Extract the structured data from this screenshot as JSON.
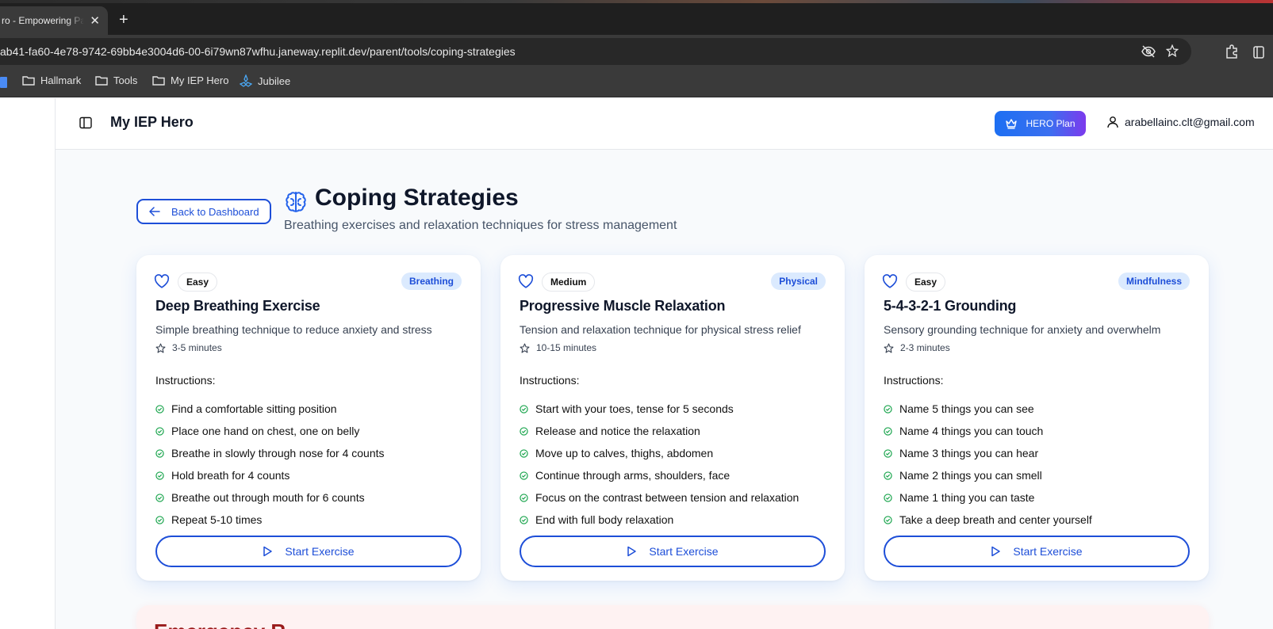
{
  "browser": {
    "tab_title": "ro - Empowering Pa",
    "tab_close": "✕",
    "new_tab": "+",
    "url": "ab41-fa60-4e78-9742-69bb4e3004d6-00-6i79wn87wfhu.janeway.replit.dev/parent/tools/coping-strategies",
    "bookmarks": [
      "Hallmark",
      "Tools",
      "My IEP Hero",
      "Jubilee"
    ]
  },
  "header": {
    "app_title": "My IEP Hero",
    "plan_label": "HERO Plan",
    "user_email": "arabellainc.clt@gmail.com"
  },
  "page": {
    "back_label": "Back to Dashboard",
    "title": "Coping Strategies",
    "subtitle": "Breathing exercises and relaxation techniques for stress management"
  },
  "cards": [
    {
      "difficulty": "Easy",
      "category": "Breathing",
      "title": "Deep Breathing Exercise",
      "description": "Simple breathing technique to reduce anxiety and stress",
      "duration": "3-5 minutes",
      "instructions_label": "Instructions:",
      "steps": [
        "Find a comfortable sitting position",
        "Place one hand on chest, one on belly",
        "Breathe in slowly through nose for 4 counts",
        "Hold breath for 4 counts",
        "Breathe out through mouth for 6 counts",
        "Repeat 5-10 times"
      ],
      "button_label": "Start Exercise"
    },
    {
      "difficulty": "Medium",
      "category": "Physical",
      "title": "Progressive Muscle Relaxation",
      "description": "Tension and relaxation technique for physical stress relief",
      "duration": "10-15 minutes",
      "instructions_label": "Instructions:",
      "steps": [
        "Start with your toes, tense for 5 seconds",
        "Release and notice the relaxation",
        "Move up to calves, thighs, abdomen",
        "Continue through arms, shoulders, face",
        "Focus on the contrast between tension and relaxation",
        "End with full body relaxation"
      ],
      "button_label": "Start Exercise"
    },
    {
      "difficulty": "Easy",
      "category": "Mindfulness",
      "title": "5-4-3-2-1 Grounding",
      "description": "Sensory grounding technique for anxiety and overwhelm",
      "duration": "2-3 minutes",
      "instructions_label": "Instructions:",
      "steps": [
        "Name 5 things you can see",
        "Name 4 things you can touch",
        "Name 3 things you can hear",
        "Name 2 things you can smell",
        "Name 1 thing you can taste",
        "Take a deep breath and center yourself"
      ],
      "button_label": "Start Exercise"
    }
  ],
  "next_section": {
    "title": "Emergency R"
  },
  "colors": {
    "accent": "#1d4ed8",
    "check": "#16a34a",
    "badge_bg": "#dbeafe",
    "emergency_bg": "#fef2f2"
  }
}
